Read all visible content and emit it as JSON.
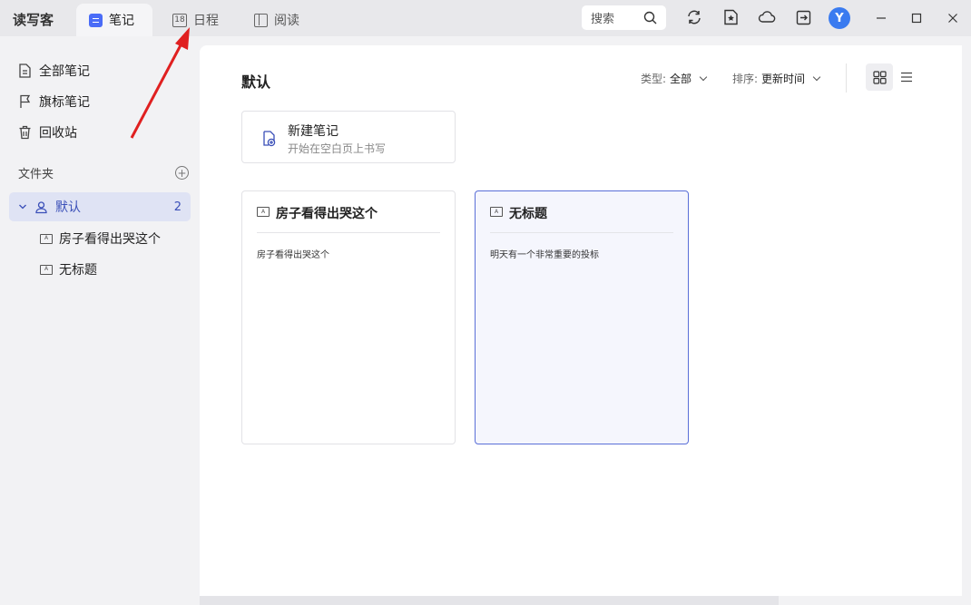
{
  "app": {
    "name": "读写客"
  },
  "tabs": [
    {
      "label": "笔记",
      "active": true
    },
    {
      "label": "日程",
      "icon_text": "18",
      "active": false
    },
    {
      "label": "阅读",
      "active": false
    }
  ],
  "toolbar": {
    "search_label": "搜索",
    "avatar_letter": "Y"
  },
  "sidebar": {
    "items": [
      {
        "label": "全部笔记",
        "icon": "document-icon"
      },
      {
        "label": "旗标笔记",
        "icon": "flag-icon"
      },
      {
        "label": "回收站",
        "icon": "trash-icon"
      }
    ],
    "folders_title": "文件夹",
    "folder": {
      "label": "默认",
      "count": "2",
      "expanded": true
    },
    "notes": [
      {
        "label": "房子看得出哭这个"
      },
      {
        "label": "无标题"
      }
    ]
  },
  "main": {
    "title": "默认",
    "type_filter": {
      "label": "类型:",
      "value": "全部"
    },
    "sort_filter": {
      "label": "排序:",
      "value": "更新时间"
    },
    "view_mode": "grid",
    "new_note": {
      "title": "新建笔记",
      "subtitle": "开始在空白页上书写"
    },
    "cards": [
      {
        "title": "房子看得出哭这个",
        "body": "房子看得出哭这个",
        "selected": false
      },
      {
        "title": "无标题",
        "body": "明天有一个非常重要的投标",
        "selected": true
      }
    ]
  },
  "colors": {
    "accent": "#4a6cf7",
    "avatar": "#3a7bf0",
    "annotation_arrow": "#e02020"
  }
}
